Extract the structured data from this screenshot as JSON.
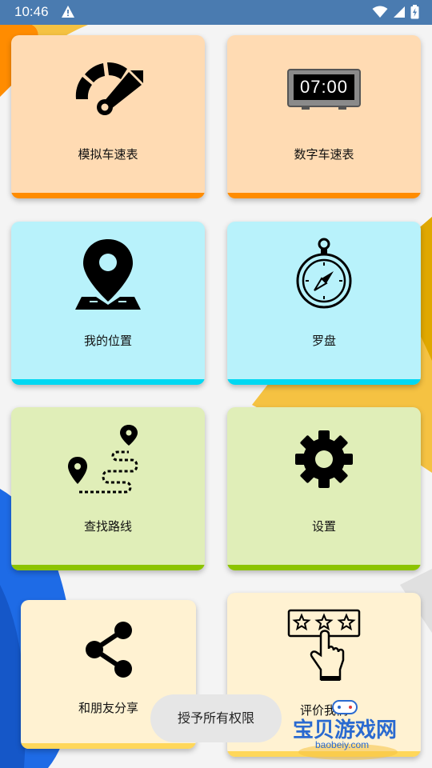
{
  "status": {
    "time": "10:46"
  },
  "tiles": [
    {
      "label": "模拟车速表",
      "icon": "analog-speedometer-icon"
    },
    {
      "label": "数字车速表",
      "icon": "digital-speedometer-icon",
      "display": "07:00"
    },
    {
      "label": "我的位置",
      "icon": "map-pin-icon"
    },
    {
      "label": "罗盘",
      "icon": "compass-icon"
    },
    {
      "label": "查找路线",
      "icon": "route-icon"
    },
    {
      "label": "设置",
      "icon": "gear-icon"
    },
    {
      "label": "和朋友分享",
      "icon": "share-icon"
    },
    {
      "label": "评价我们",
      "icon": "rating-icon"
    }
  ],
  "toast": "授予所有权限",
  "watermark": {
    "title": "宝贝游戏网",
    "url": "baobeiy.com"
  },
  "colors": {
    "status_bar": "#4a7bb0",
    "orange_card": "#ffdbb3",
    "orange_bar": "#ff8c00",
    "cyan_card": "#b8f2fb",
    "cyan_bar": "#00d8f2",
    "green_card": "#e0eeb8",
    "green_bar": "#8cc400",
    "yellow_card": "#fff2d2",
    "yellow_bar": "#ffd75a"
  }
}
